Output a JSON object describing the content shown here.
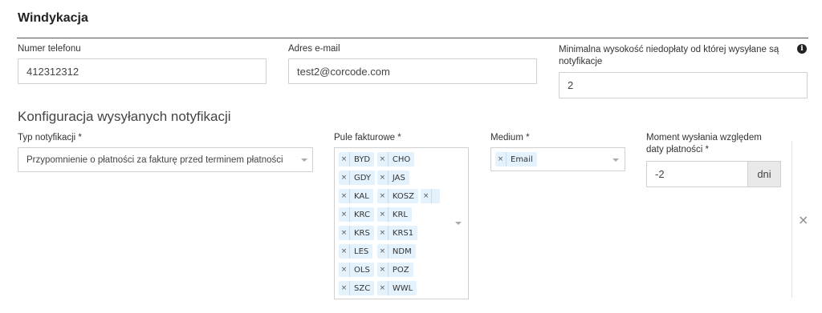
{
  "section": {
    "title": "Windykacja"
  },
  "contact": {
    "phone_label": "Numer telefonu",
    "phone_value": "412312312",
    "email_label": "Adres e-mail",
    "email_value": "test2@corcode.com",
    "min_amount_label_line1": "Minimalna wysokość niedopłaty od której wysyłane są",
    "min_amount_label_line2": "notyfikacje",
    "min_amount_value": "2",
    "info_icon": "info-icon"
  },
  "config": {
    "title": "Konfiguracja wysyłanych notyfikacji",
    "type_label": "Typ notyfikacji *",
    "type_value": "Przypomnienie o płatności za fakturę przed terminem płatności",
    "pools_label": "Pule fakturowe *",
    "pools": [
      "BYD",
      "CHO",
      "GDY",
      "JAS",
      "KAL",
      "KOSZ",
      "",
      "KRC",
      "KRL",
      "KRS",
      "KRS1",
      "LES",
      "NDM",
      "OLS",
      "POZ",
      "SZC",
      "WWL"
    ],
    "medium_label": "Medium *",
    "medium_tags": [
      "Email"
    ],
    "moment_label_line1": "Moment wysłania względem",
    "moment_label_line2": "daty płatności *",
    "moment_value": "-2",
    "moment_unit": "dni",
    "tag_remove_glyph": "×",
    "remove_row_glyph": "×"
  }
}
